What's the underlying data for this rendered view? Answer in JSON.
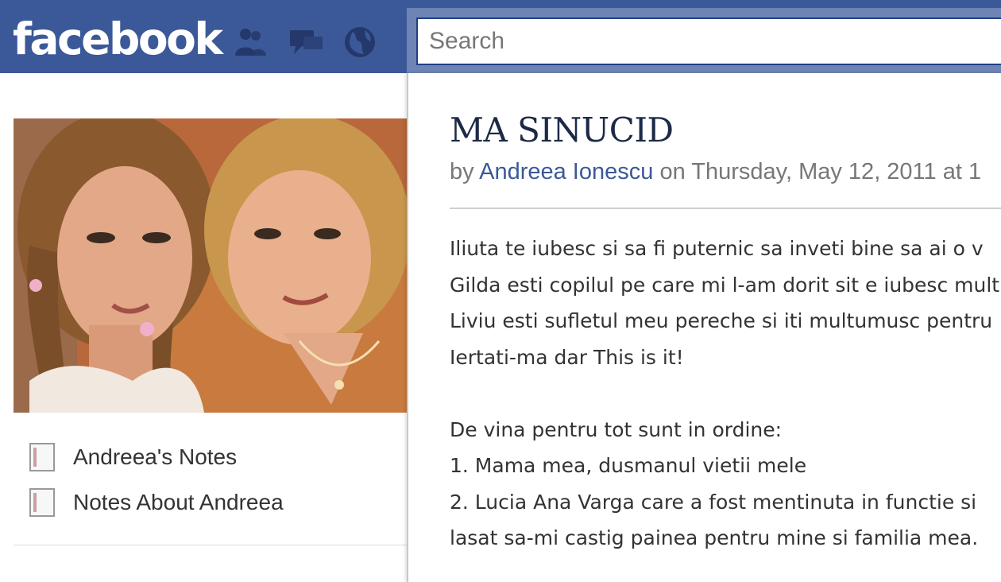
{
  "header": {
    "logo": "facebook",
    "search_placeholder": "Search",
    "icons": [
      "friend-requests-icon",
      "messages-icon",
      "notifications-globe-icon"
    ],
    "colors": {
      "bar": "#3b5998",
      "search_border": "#1d4088",
      "link": "#3b5998"
    }
  },
  "sidebar": {
    "links": [
      {
        "label": "Andreea's Notes",
        "icon": "note-document-icon"
      },
      {
        "label": "Notes About Andreea",
        "icon": "note-document-icon"
      }
    ]
  },
  "note": {
    "title": "MA SINUCID",
    "by_prefix": "by",
    "author": "Andreea Ionescu",
    "date_text": "on Thursday, May 12, 2011 at 1",
    "body": [
      "Iliuta te iubesc si sa fi puternic sa inveti bine sa ai o v",
      "Gilda esti copilul pe care mi l-am dorit sit e iubesc mult",
      "Liviu esti sufletul meu pereche si iti multumusc pentru",
      "Iertati-ma dar This is it!",
      "",
      "De vina pentru tot sunt in ordine:",
      "1. Mama mea, dusmanul vietii mele",
      "2. Lucia Ana Varga care a fost mentinuta in functie si",
      "lasat sa-mi castig painea pentru mine si familia mea."
    ]
  }
}
